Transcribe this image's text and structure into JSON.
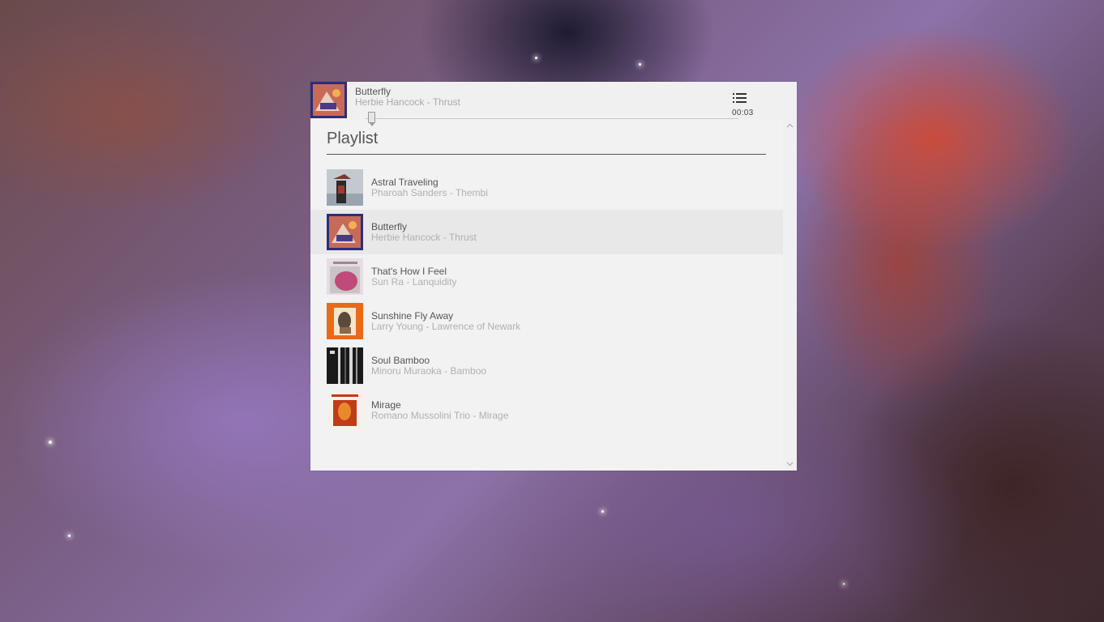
{
  "now_playing": {
    "title": "Butterfly",
    "subtitle": "Herbie Hancock - Thrust",
    "time": "00:03",
    "progress_fraction": 0.02,
    "menu_icon": "list-icon"
  },
  "playlist": {
    "heading": "Playlist",
    "active_index": 1,
    "items": [
      {
        "title": "Astral Traveling",
        "subtitle": "Pharoah Sanders - Thembi",
        "art_colors": [
          "#c4c9d0",
          "#7a3a2a",
          "#2b2b2b"
        ]
      },
      {
        "title": "Butterfly",
        "subtitle": "Herbie Hancock - Thrust",
        "art_colors": [
          "#2d2d7a",
          "#c86a5a",
          "#e8d0c0"
        ]
      },
      {
        "title": "That's How I Feel",
        "subtitle": "Sun Ra - Lanquidity",
        "art_colors": [
          "#c9c4c8",
          "#c04a7a",
          "#e6dde0"
        ]
      },
      {
        "title": "Sunshine Fly Away",
        "subtitle": "Larry Young - Lawrence of Newark",
        "art_colors": [
          "#e86a1c",
          "#f2e6cc",
          "#5a4a3a"
        ]
      },
      {
        "title": "Soul Bamboo",
        "subtitle": "Minoru Muraoka - Bamboo",
        "art_colors": [
          "#1a1a1a",
          "#d8d8d8",
          "#5a5a5a"
        ]
      },
      {
        "title": "Mirage",
        "subtitle": "Romano Mussolini Trio - Mirage",
        "art_colors": [
          "#f5f2ea",
          "#c23a18",
          "#e88a2a"
        ]
      }
    ]
  },
  "scrollbar": {
    "up_icon": "chevron-up-icon",
    "down_icon": "chevron-down-icon"
  }
}
